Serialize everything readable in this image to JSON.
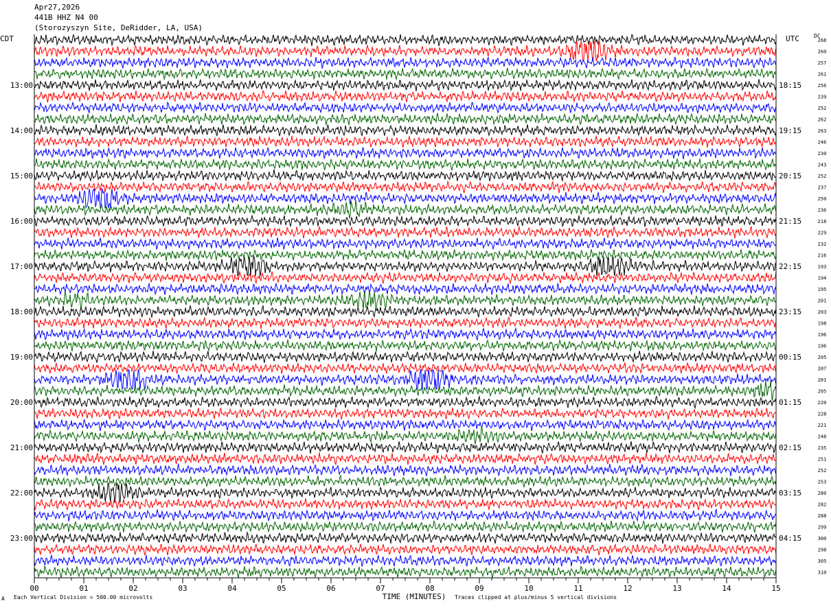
{
  "header": {
    "date": "Apr27,2026",
    "station": "441B HHZ N4 00",
    "site": "(Storozyszyn Site, DeRidder, LA, USA)"
  },
  "left_tz": "CDT",
  "right_tz": "UTC",
  "dc_label": "DC",
  "footer": {
    "marker": "A",
    "scale_note": "Each Vertical Division =  500.00 microvolts",
    "clip_note": "Traces clipped at plus/minus 5 vertical divisions"
  },
  "colors": [
    "#000000",
    "#ff0000",
    "#0000ff",
    "#006400"
  ],
  "chart_data": {
    "type": "line",
    "xlabel": "TIME (MINUTES)",
    "xticks": [
      "00",
      "01",
      "02",
      "03",
      "04",
      "05",
      "06",
      "07",
      "08",
      "09",
      "10",
      "11",
      "12",
      "13",
      "14",
      "15"
    ],
    "xlim": [
      0,
      15
    ],
    "minutes_per_trace": 15,
    "left_hour_labels": [
      "13:00",
      "14:00",
      "15:00",
      "16:00",
      "17:00",
      "18:00",
      "19:00",
      "20:00",
      "21:00",
      "22:00",
      "23:00"
    ],
    "right_hour_labels": [
      "18:15",
      "19:15",
      "20:15",
      "21:15",
      "22:15",
      "23:15",
      "00:15",
      "01:15",
      "02:15",
      "03:15",
      "04:15"
    ],
    "first_labeled_trace": 4,
    "traces_per_hour": 4,
    "dc_offsets": [
      "268",
      "260",
      "257",
      "261",
      "256",
      "239",
      "252",
      "262",
      "263",
      "246",
      "230",
      "243",
      "252",
      "237",
      "250",
      "236",
      "218",
      "229",
      "232",
      "216",
      "193",
      "194",
      "195",
      "201",
      "203",
      "198",
      "196",
      "196",
      "205",
      "207",
      "201",
      "205",
      "220",
      "228",
      "221",
      "248",
      "235",
      "251",
      "252",
      "253",
      "280",
      "282",
      "288",
      "299",
      "300",
      "298",
      "305",
      "310"
    ],
    "events": [
      {
        "trace": 1,
        "minute": 11.2,
        "amp": 3.5
      },
      {
        "trace": 14,
        "minute": 1.3,
        "amp": 3.0
      },
      {
        "trace": 15,
        "minute": 6.4,
        "amp": 1.2
      },
      {
        "trace": 20,
        "minute": 4.3,
        "amp": 2.2
      },
      {
        "trace": 20,
        "minute": 11.6,
        "amp": 2.6
      },
      {
        "trace": 23,
        "minute": 0.8,
        "amp": 1.2
      },
      {
        "trace": 23,
        "minute": 6.8,
        "amp": 1.6
      },
      {
        "trace": 30,
        "minute": 1.9,
        "amp": 3.0
      },
      {
        "trace": 30,
        "minute": 8.0,
        "amp": 3.4
      },
      {
        "trace": 31,
        "minute": 14.9,
        "amp": 1.5
      },
      {
        "trace": 35,
        "minute": 8.9,
        "amp": 1.3
      },
      {
        "trace": 40,
        "minute": 1.6,
        "amp": 2.2
      }
    ]
  }
}
